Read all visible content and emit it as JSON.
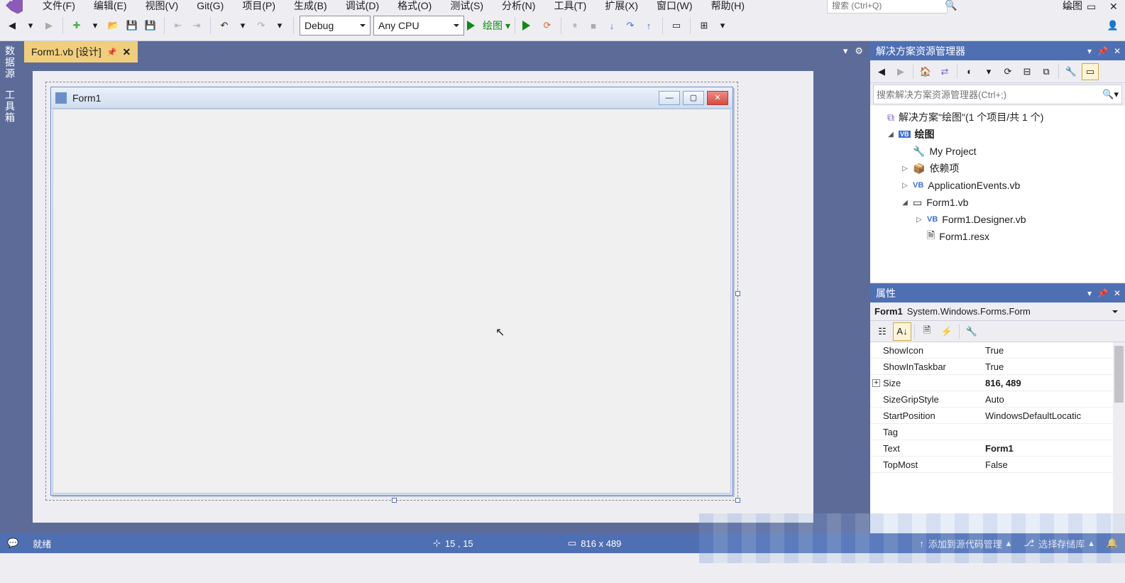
{
  "menu": {
    "items": [
      "文件(F)",
      "编辑(E)",
      "视图(V)",
      "Git(G)",
      "项目(P)",
      "生成(B)",
      "调试(D)",
      "格式(O)",
      "测试(S)",
      "分析(N)",
      "工具(T)",
      "扩展(X)",
      "窗口(W)",
      "帮助(H)"
    ],
    "search_placeholder": "搜索 (Ctrl+Q)",
    "title_right": "绘图"
  },
  "toolbar": {
    "config": "Debug",
    "platform": "Any CPU",
    "run_label": "绘图"
  },
  "left_rail": {
    "items": [
      "数据源",
      "工具箱"
    ]
  },
  "tabs": {
    "active": "Form1.vb [设计]"
  },
  "form": {
    "title": "Form1"
  },
  "solution_explorer": {
    "title": "解决方案资源管理器",
    "search_placeholder": "搜索解决方案资源管理器(Ctrl+;)",
    "root": "解决方案\"绘图\"(1 个项目/共 1 个)",
    "project": "绘图",
    "items": {
      "my_project": "My Project",
      "deps": "依赖项",
      "app_events": "ApplicationEvents.vb",
      "form1": "Form1.vb",
      "form1_designer": "Form1.Designer.vb",
      "form1_resx": "Form1.resx"
    }
  },
  "properties": {
    "title": "属性",
    "object_name": "Form1",
    "object_type": "System.Windows.Forms.Form",
    "rows": [
      {
        "name": "ShowIcon",
        "value": "True",
        "bold": false
      },
      {
        "name": "ShowInTaskbar",
        "value": "True",
        "bold": false
      },
      {
        "name": "Size",
        "value": "816, 489",
        "bold": true,
        "expandable": true
      },
      {
        "name": "SizeGripStyle",
        "value": "Auto",
        "bold": false
      },
      {
        "name": "StartPosition",
        "value": "WindowsDefaultLocatic",
        "bold": false
      },
      {
        "name": "Tag",
        "value": "",
        "bold": false
      },
      {
        "name": "Text",
        "value": "Form1",
        "bold": true
      },
      {
        "name": "TopMost",
        "value": "False",
        "bold": false
      }
    ]
  },
  "status": {
    "ready": "就绪",
    "pos": "15 , 15",
    "size": "816 x 489",
    "add_source": "添加到源代码管理",
    "select_repo": "选择存储库"
  }
}
